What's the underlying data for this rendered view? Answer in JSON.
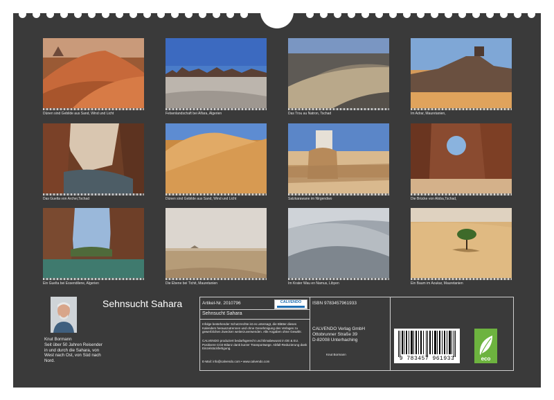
{
  "calendar": {
    "title": "Sehnsucht Sahara",
    "captions": [
      "Dünen sind Gebilde aus Sand, Wind und Licht",
      "Felsenlandschaft bei Aïfara, Algerien",
      "Das Trou au Natron, Tschad",
      "Im Adrar, Mauretanien,",
      "Das Guelta von Archei,Tschad",
      "Dünen sind Gebilde aus Sand, Wind und Licht",
      "Salzkarawane im Nirgendwo",
      "Die Brücke von Aloba,Tschad,",
      "Ein Guelta bei Essendilene, Algerien",
      "Die Ebene bei Tichit, Mauretanien",
      "Im Krater Wau en Namus, Libyen",
      "Ein Baum im Aoukar, Mauretanien"
    ]
  },
  "author": {
    "name": "Knut Bormann",
    "bio": "Seit über 50 Jahren Reisender in und durch die Sahara, von West nach Ost, von Süd nach Nord."
  },
  "info": {
    "article": "Artikel-Nr. 2010796",
    "product_title": "Sehnsucht Sahara",
    "isbn": "ISBN 9783457961933",
    "publisher": [
      "CALVENDO Verlag GmbH",
      "Ottobrunner Straße 39",
      "D-82008 Unterhaching"
    ],
    "author_small": "Knut Bormann",
    "copyright": "Infolge bestehender Schutzrechte ist es untersagt, die Blätter dieses Kalenders herauszutrennen und ohne Genehmigung des Verlages zu gewerblichen Zwecken weiterzuverwenden. Alle Angaben ohne Gewähr.",
    "eco_note": "CALVENDO produziert bedarfsgerecht und klimabewusst in DE & EU. Positivere CO2-Bilanz dank kurzer Transportwege. Abfall-Reduzierung dank Einzelstückfertigung.",
    "contact": "E-Mail: info@calvendo.com • www.calvendo.com",
    "calvendo_logo": "CALVENDO",
    "barcode_number": "9 783457 961933",
    "eco_label": "eco"
  },
  "colors": {
    "background": "#3a3a3a",
    "text": "#eeeeee"
  }
}
